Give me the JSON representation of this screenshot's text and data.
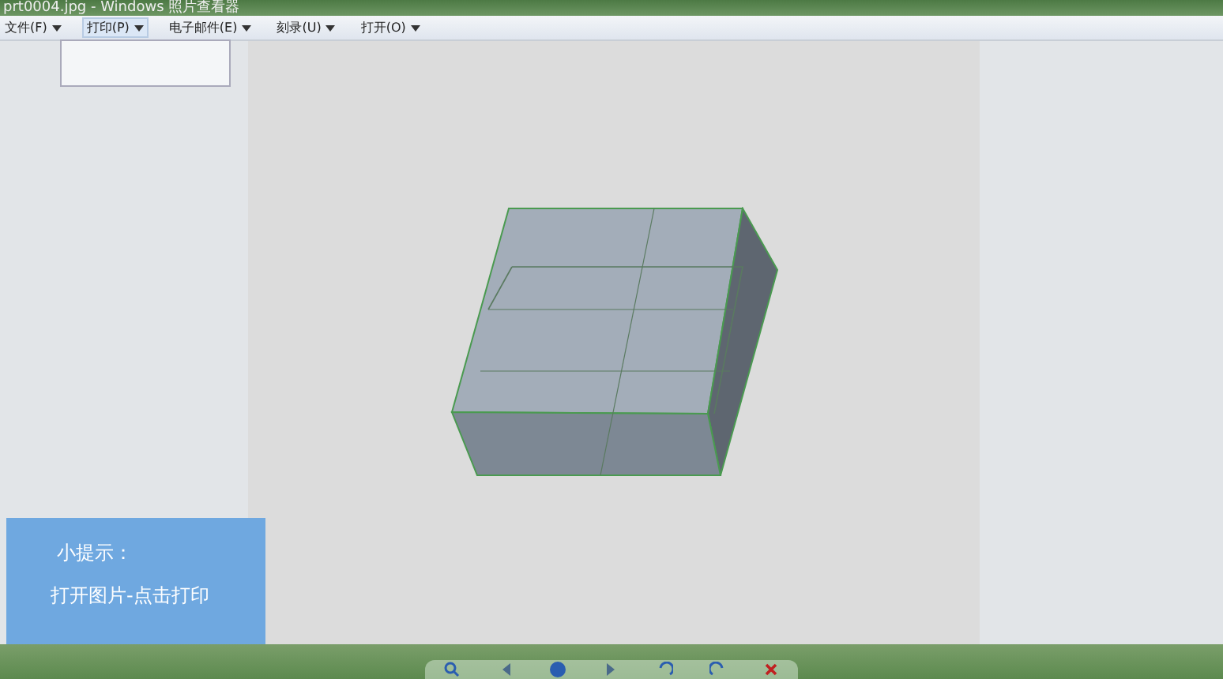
{
  "window": {
    "title": "prt0004.jpg - Windows 照片查看器"
  },
  "menu": [
    {
      "label": "文件(F)",
      "expanded": false
    },
    {
      "label": "打印(P)",
      "expanded": true
    },
    {
      "label": "电子邮件(E)",
      "expanded": false
    },
    {
      "label": "刻录(U)",
      "expanded": false
    },
    {
      "label": "打开(O)",
      "expanded": false
    }
  ],
  "hint": {
    "title": "小提示：",
    "text": "打开图片-点击打印"
  }
}
